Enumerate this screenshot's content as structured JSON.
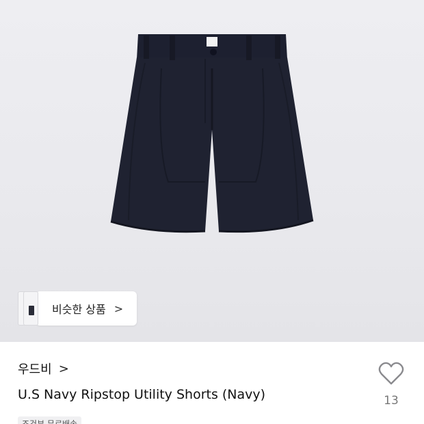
{
  "product_image": {
    "alt": "U.S Navy Ripstop Utility Shorts (Navy)",
    "color": "#1f2230",
    "background": "#ebebef"
  },
  "similar_products": {
    "label": "비슷한 상품",
    "chevron": ">"
  },
  "brand": {
    "name": "우드비",
    "chevron": ">"
  },
  "product": {
    "title": "U.S Navy Ripstop Utility Shorts (Navy)",
    "tag": "조건부 무료배송"
  },
  "like": {
    "icon": "heart-outline-icon",
    "count": "13"
  }
}
